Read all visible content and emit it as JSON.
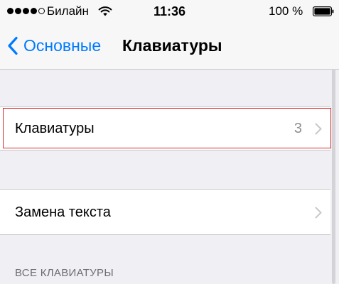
{
  "status_bar": {
    "carrier": "Билайн",
    "time": "11:36",
    "battery_percent": "100 %",
    "signal_bars_filled": 4,
    "signal_bars_total": 5
  },
  "nav": {
    "back_label": "Основные",
    "title": "Клавиатуры"
  },
  "rows": [
    {
      "label": "Клавиатуры",
      "value": "3"
    },
    {
      "label": "Замена текста"
    }
  ],
  "section_header": "ВСЕ КЛАВИАТУРЫ",
  "icons": {
    "signal": "signal-dots-icon",
    "wifi": "wifi-icon",
    "battery": "battery-icon",
    "back": "chevron-left-icon",
    "disclosure": "chevron-right-icon"
  },
  "colors": {
    "accent": "#007aff",
    "background": "#efeff4",
    "cell_background": "#ffffff",
    "highlight": "#d32f2f",
    "secondary_text": "#8e8e93"
  }
}
